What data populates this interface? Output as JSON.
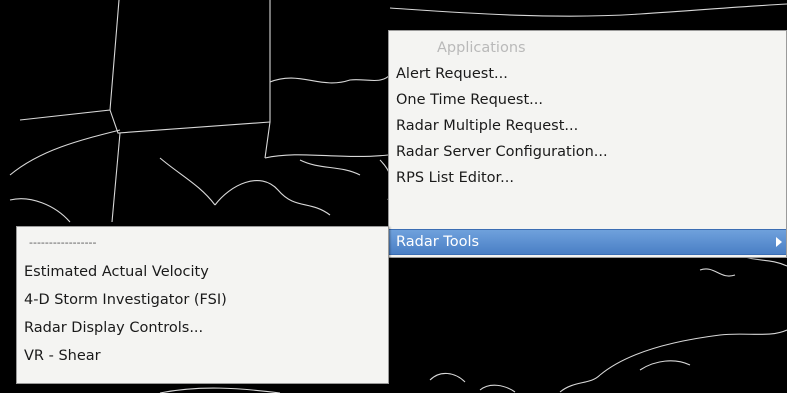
{
  "applications_menu": {
    "header": "Applications",
    "items": [
      {
        "label": "Alert Request..."
      },
      {
        "label": "One Time Request..."
      },
      {
        "label": "Radar Multiple Request..."
      },
      {
        "label": "Radar Server Configuration..."
      },
      {
        "label": "RPS List Editor..."
      },
      {
        "label": "Radar Tools"
      }
    ]
  },
  "radar_tools_menu": {
    "separator": "-----------------",
    "items": [
      {
        "label": "Estimated Actual Velocity"
      },
      {
        "label": "4-D Storm Investigator (FSI)"
      },
      {
        "label": "Radar Display Controls..."
      },
      {
        "label": "VR - Shear"
      }
    ]
  },
  "colors": {
    "background": "#000000",
    "menu_background": "#f4f4f2",
    "highlight": "#4a7fc5",
    "map_lines": "#d8d8d8"
  }
}
